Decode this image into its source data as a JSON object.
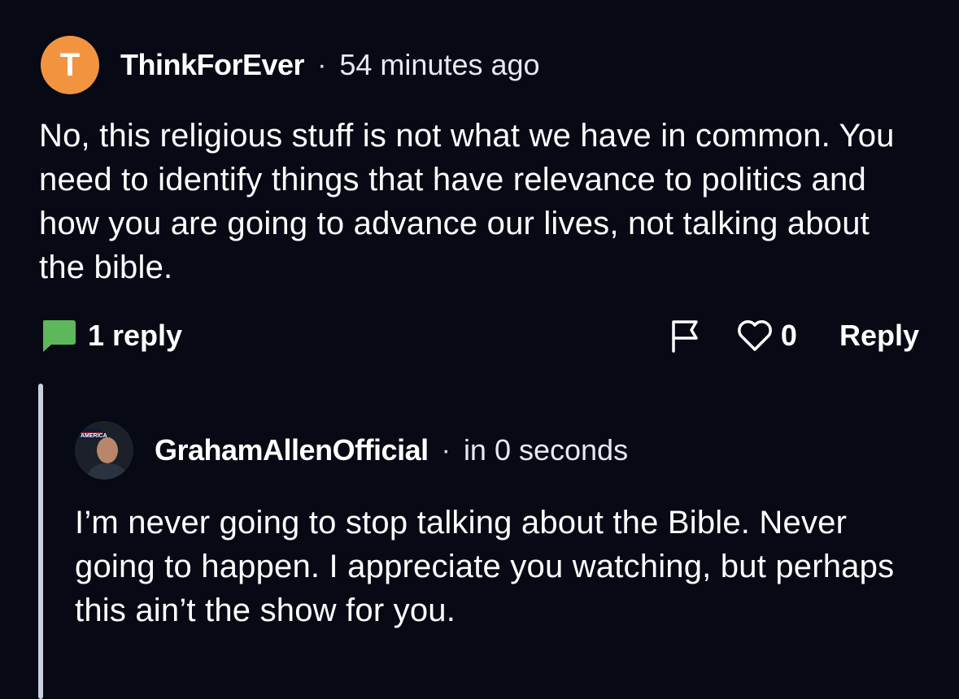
{
  "comment": {
    "avatar_letter": "T",
    "avatar_color": "#f2943f",
    "username": "ThinkForEver",
    "separator": "·",
    "timestamp": "54 minutes ago",
    "body": "No, this religious stuff is not what we have in common. You need to identify things that have relevance to politics and how you are going to advance our lives, not talking about the bible.",
    "replies_icon": "chat-bubble-icon",
    "replies_icon_color": "#5db75b",
    "replies_label": "1 reply",
    "flag_icon": "flag-icon",
    "like_icon": "heart-icon",
    "like_count": "0",
    "reply_label": "Reply"
  },
  "reply": {
    "avatar_badge_text": "AMERICA",
    "username": "GrahamAllenOfficial",
    "separator": "·",
    "timestamp": "in 0 seconds",
    "body": "I’m never going to stop talking about the Bible. Never going to happen. I appreciate you watching, but perhaps this ain’t the show for you."
  },
  "colors": {
    "background": "#070915",
    "thread_line": "#c9d0e2"
  }
}
